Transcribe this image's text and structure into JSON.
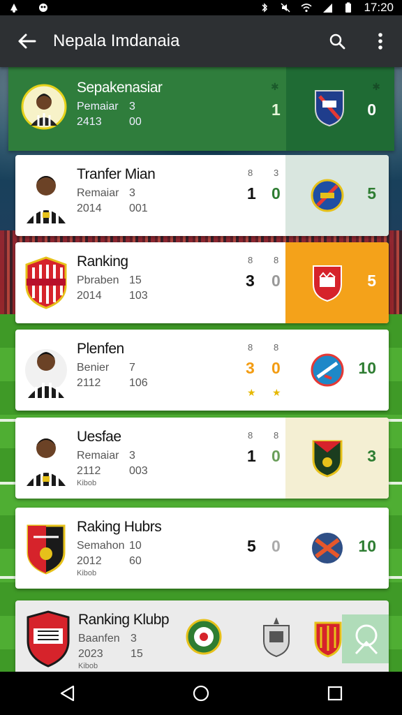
{
  "status_bar": {
    "time": "17:20",
    "icons": [
      "bluetooth-icon",
      "mute-icon",
      "wifi-icon",
      "signal-icon",
      "battery-icon"
    ]
  },
  "app_bar": {
    "title": "Nepala Imdanaia",
    "back_icon": "arrow-left-icon",
    "search_icon": "search-icon",
    "menu_icon": "more-vert-icon"
  },
  "cards": [
    {
      "name": "Sepakenasiar",
      "line2_a": "Pemaiar",
      "line2_b": "3",
      "line3_a": "2413",
      "line3_b": "00",
      "line4": "",
      "mini_a": "",
      "mini_b": "",
      "score_a": "",
      "score_b": "1",
      "points": "0",
      "accent": "#1f6b34"
    },
    {
      "name": "Tranfer Mian",
      "line2_a": "Remaiar",
      "line2_b": "3",
      "line3_a": "2014",
      "line3_b": "001",
      "line4": "",
      "mini_a": "8",
      "mini_b": "3",
      "score_a": "1",
      "score_b": "0",
      "points": "5",
      "accent": "#d9e6df"
    },
    {
      "name": "Ranking",
      "line2_a": "Pbraben",
      "line2_b": "15",
      "line3_a": "2014",
      "line3_b": "103",
      "line4": "",
      "mini_a": "8",
      "mini_b": "8",
      "score_a": "3",
      "score_b": "0",
      "points": "5",
      "accent": "#f4a21a"
    },
    {
      "name": "Plenfen",
      "line2_a": "Benier",
      "line2_b": "7",
      "line3_a": "2112",
      "line3_b": "106",
      "line4": "",
      "mini_a": "8",
      "mini_b": "8",
      "score_a": "3",
      "score_b": "0",
      "points": "10",
      "accent": "#ffffff"
    },
    {
      "name": "Uesfae",
      "line2_a": "Remaiar",
      "line2_b": "3",
      "line3_a": "2112",
      "line3_b": "003",
      "line4": "Kibob",
      "mini_a": "8",
      "mini_b": "8",
      "score_a": "1",
      "score_b": "0",
      "points": "3",
      "accent": "#f4efd3"
    },
    {
      "name": "Raking Hubrs",
      "line2_a": "Semahon",
      "line2_b": "10",
      "line3_a": "2012",
      "line3_b": "60",
      "line4": "Kibob",
      "mini_a": "",
      "mini_b": "",
      "score_a": "5",
      "score_b": "0",
      "points": "10",
      "accent": "#ffffff"
    },
    {
      "name": "Ranking Klubp",
      "line2_a": "Baanfen",
      "line2_b": "3",
      "line3_a": "2023",
      "line3_b": "15",
      "line4": "Kibob",
      "mini_a": "",
      "mini_b": "",
      "score_a": "",
      "score_b": "",
      "points": "",
      "accent": "#ebebeb"
    }
  ],
  "nav": {
    "back": "triangle-back-icon",
    "home": "circle-home-icon",
    "recents": "square-recents-icon"
  }
}
